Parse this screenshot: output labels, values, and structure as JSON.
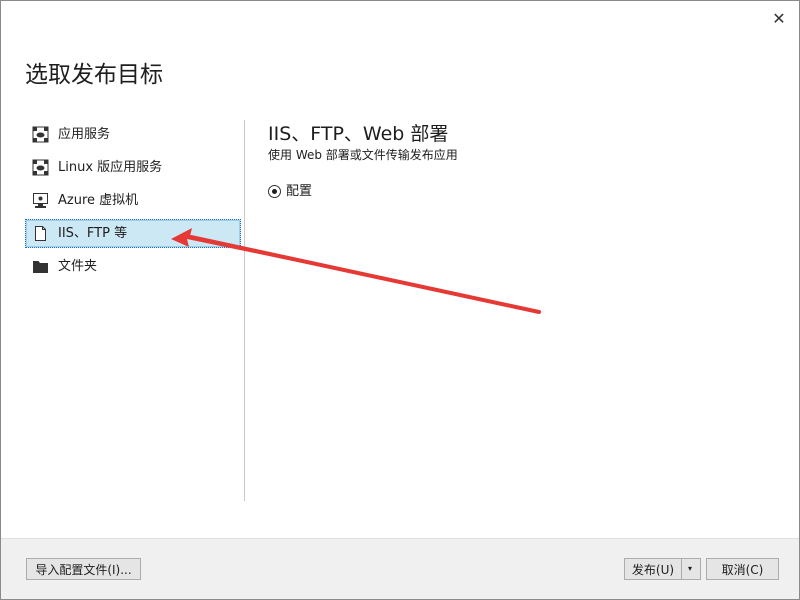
{
  "dialog": {
    "title": "选取发布目标",
    "close_label": "✕"
  },
  "sidebar": {
    "items": [
      {
        "label": "应用服务",
        "icon": "cloud-app-icon"
      },
      {
        "label": "Linux 版应用服务",
        "icon": "cloud-app-icon"
      },
      {
        "label": "Azure 虚拟机",
        "icon": "monitor-icon"
      },
      {
        "label": "IIS、FTP 等",
        "icon": "document-icon",
        "selected": true
      },
      {
        "label": "文件夹",
        "icon": "folder-icon"
      }
    ]
  },
  "content": {
    "title": "IIS、FTP、Web 部署",
    "subtitle": "使用 Web 部署或文件传输发布应用",
    "radio_label": "配置",
    "radio_checked": true
  },
  "footer": {
    "import_label": "导入配置文件(I)...",
    "publish_label": "发布(U)",
    "publish_dropdown": "▾",
    "cancel_label": "取消(C)"
  },
  "colors": {
    "selected_bg": "#cce8f4",
    "annotation_arrow": "#e53935"
  }
}
